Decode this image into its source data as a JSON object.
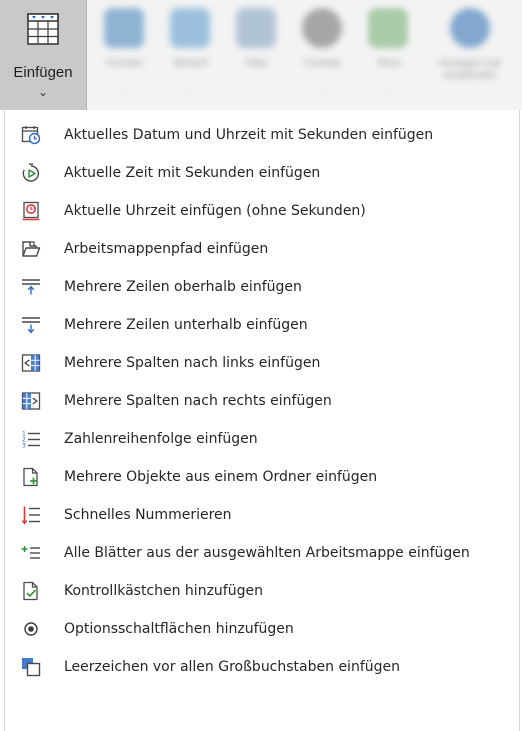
{
  "ribbon": {
    "insert_label": "Einfügen",
    "insert_chevron": "⌄",
    "blurred_groups": [
      {
        "label": "Formeln"
      },
      {
        "label": "Bereich"
      },
      {
        "label": "Filter"
      },
      {
        "label": "Formeln"
      },
      {
        "label": "Pivot"
      },
      {
        "label": "Anzeigen und Ausblenden"
      }
    ]
  },
  "colors": {
    "accent_blue": "#2b6cc4",
    "accent_red": "#d83b3b",
    "accent_green": "#2e8b3a",
    "icon_gray": "#4a4a4a",
    "ribbon_bg": "#c9c9c9"
  },
  "menu": {
    "items": [
      {
        "icon": "calendar-clock-icon",
        "label": "Aktuelles Datum und Uhrzeit mit Sekunden einfügen"
      },
      {
        "icon": "stopwatch-icon",
        "label": "Aktuelle Zeit mit Sekunden einfügen"
      },
      {
        "icon": "clock-red-icon",
        "label": "Aktuelle Uhrzeit einfügen (ohne Sekunden)"
      },
      {
        "icon": "folder-path-icon",
        "label": "Arbeitsmappenpfad einfügen"
      },
      {
        "icon": "insert-rows-above-icon",
        "label": "Mehrere Zeilen oberhalb einfügen"
      },
      {
        "icon": "insert-rows-below-icon",
        "label": "Mehrere Zeilen unterhalb einfügen"
      },
      {
        "icon": "insert-columns-left-icon",
        "label": "Mehrere Spalten nach links einfügen"
      },
      {
        "icon": "insert-columns-right-icon",
        "label": "Mehrere Spalten nach rechts einfügen"
      },
      {
        "icon": "number-sequence-icon",
        "label": "Zahlenreihenfolge einfügen"
      },
      {
        "icon": "insert-objects-icon",
        "label": "Mehrere Objekte aus einem Ordner einfügen"
      },
      {
        "icon": "quick-numbering-icon",
        "label": "Schnelles Nummerieren"
      },
      {
        "icon": "add-sheets-icon",
        "label": "Alle Blätter aus der ausgewählten Arbeitsmappe einfügen"
      },
      {
        "icon": "checkbox-icon",
        "label": "Kontrollkästchen hinzufügen"
      },
      {
        "icon": "radio-button-icon",
        "label": "Optionsschaltflächen hinzufügen"
      },
      {
        "icon": "space-before-capitals-icon",
        "label": "Leerzeichen vor allen Großbuchstaben einfügen"
      }
    ]
  }
}
